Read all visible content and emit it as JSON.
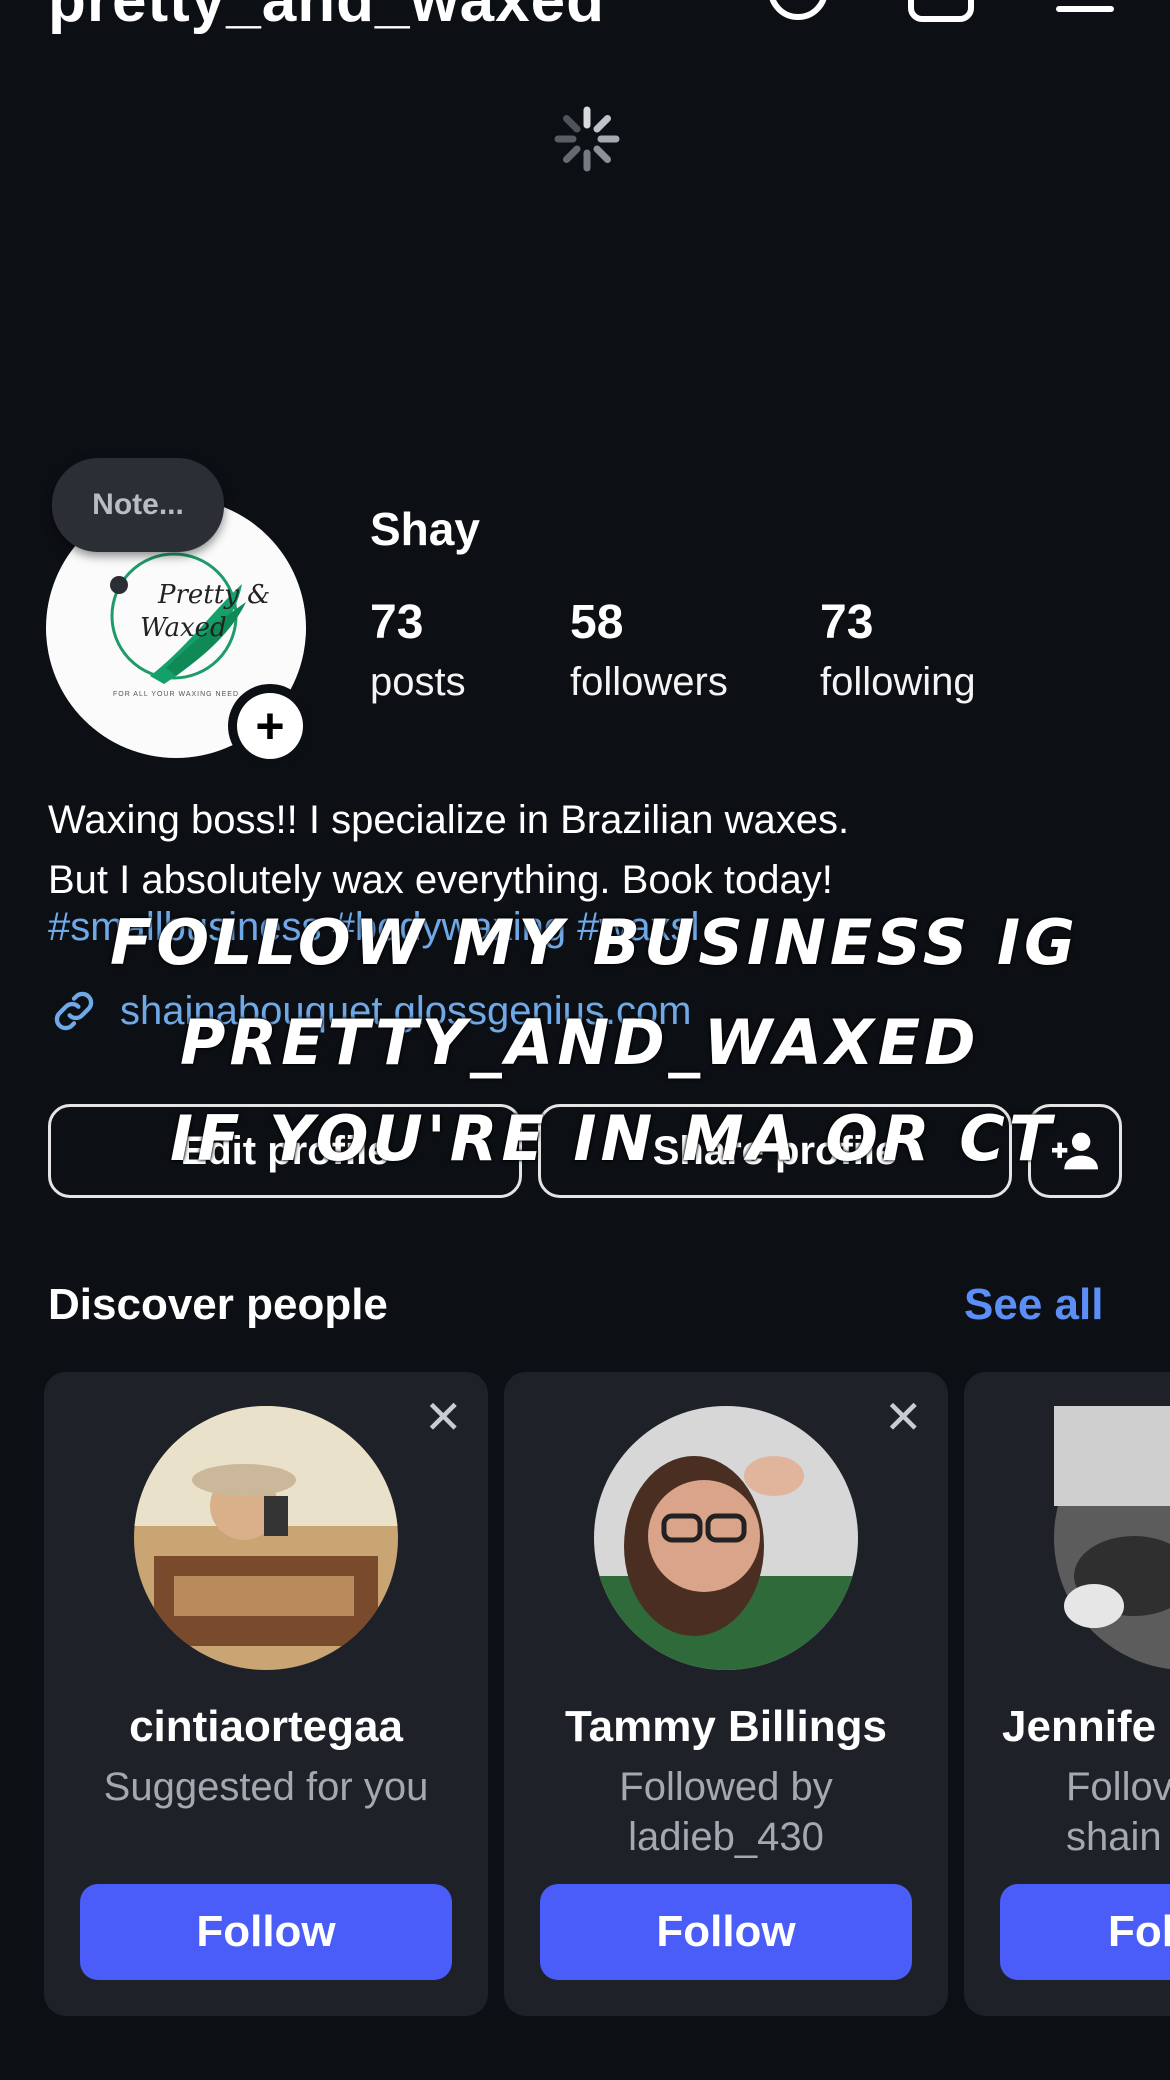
{
  "header": {
    "username": "pretty_and_waxed"
  },
  "profile": {
    "note": "Note...",
    "display_name": "Shay",
    "avatar_logo_text": "Pretty & Waxed",
    "avatar_tagline": "FOR ALL YOUR WAXING NEED",
    "stats": [
      {
        "value": "73",
        "label": "posts"
      },
      {
        "value": "58",
        "label": "followers"
      },
      {
        "value": "73",
        "label": "following"
      }
    ],
    "bio_line1": "Waxing boss!! I specialize in Brazilian waxes.",
    "bio_line2": "But I absolutely wax everything. Book today!",
    "bio_tags": "#smallbusiness #bodywaxing #waxsl",
    "link": "shainabouquet.glossgenius.com",
    "edit_profile": "Edit profile",
    "share_profile": "Share profile"
  },
  "overlay": {
    "line1": "FOLLOW MY BUSINESS IG",
    "line2": "PRETTY_AND_WAXED",
    "line3": "IF YOU'RE IN MA OR CT"
  },
  "discover": {
    "title": "Discover people",
    "see_all": "See all",
    "cards": [
      {
        "name": "cintiaortegaa",
        "sub1": "Suggested for you",
        "sub2": "",
        "follow": "Follow"
      },
      {
        "name": "Tammy Billings",
        "sub1": "Followed by",
        "sub2": "ladieb_430",
        "follow": "Follow"
      },
      {
        "name": "Jennife",
        "sub1": "Follov",
        "sub2": "shain",
        "follow": "Fol"
      }
    ]
  },
  "colors": {
    "background": "#0c0f14",
    "link": "#6fa9e8",
    "follow_button": "#4a5df9",
    "see_all": "#5b8ff7",
    "card": "#1f2128"
  },
  "icons": [
    "threads-icon",
    "add-post-icon",
    "menu-icon",
    "loading-spinner-icon",
    "plus-icon",
    "link-icon",
    "add-person-icon",
    "close-icon"
  ]
}
